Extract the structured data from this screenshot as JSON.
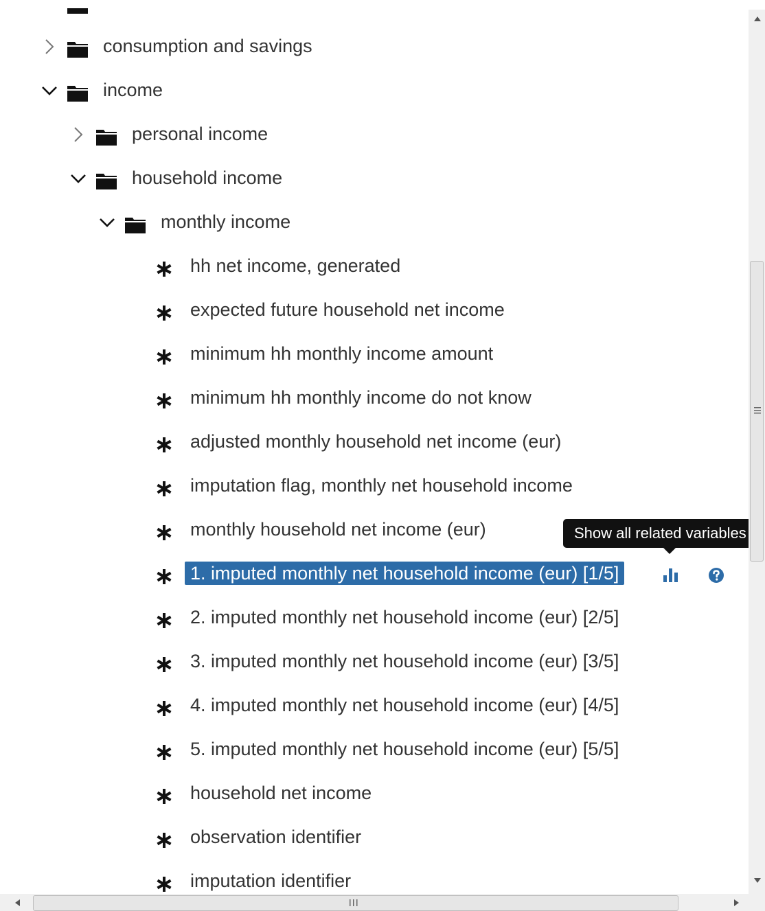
{
  "tree": {
    "nodes": [
      {
        "type": "folder",
        "level": 1,
        "state": "collapsed",
        "label": "consumption and savings"
      },
      {
        "type": "folder",
        "level": 1,
        "state": "expanded",
        "label": "income"
      },
      {
        "type": "folder",
        "level": 2,
        "state": "collapsed",
        "label": "personal income"
      },
      {
        "type": "folder",
        "level": 2,
        "state": "expanded",
        "label": "household income"
      },
      {
        "type": "folder",
        "level": 3,
        "state": "expanded",
        "label": "monthly income"
      },
      {
        "type": "variable",
        "level": 4,
        "label": "hh net income, generated"
      },
      {
        "type": "variable",
        "level": 4,
        "label": "expected future household net income"
      },
      {
        "type": "variable",
        "level": 4,
        "label": "minimum hh monthly income amount"
      },
      {
        "type": "variable",
        "level": 4,
        "label": "minimum hh monthly income do not know"
      },
      {
        "type": "variable",
        "level": 4,
        "label": "adjusted monthly household net income (eur)"
      },
      {
        "type": "variable",
        "level": 4,
        "label": "imputation flag, monthly net household income"
      },
      {
        "type": "variable",
        "level": 4,
        "label": "monthly household net income (eur)"
      },
      {
        "type": "variable",
        "level": 4,
        "label": "1. imputed monthly net household income (eur) [1/5]",
        "selected": true
      },
      {
        "type": "variable",
        "level": 4,
        "label": "2. imputed monthly net household income (eur) [2/5]"
      },
      {
        "type": "variable",
        "level": 4,
        "label": "3. imputed monthly net household income (eur) [3/5]"
      },
      {
        "type": "variable",
        "level": 4,
        "label": "4. imputed monthly net household income (eur) [4/5]"
      },
      {
        "type": "variable",
        "level": 4,
        "label": "5. imputed monthly net household income (eur) [5/5]"
      },
      {
        "type": "variable",
        "level": 4,
        "label": "household net income"
      },
      {
        "type": "variable",
        "level": 4,
        "label": "observation identifier"
      },
      {
        "type": "variable",
        "level": 4,
        "label": "imputation identifier"
      }
    ]
  },
  "tooltip": {
    "text": "Show all related variables"
  },
  "actions": {
    "related_icon": "bar-chart-icon",
    "help_icon": "question-circle-icon"
  },
  "colors": {
    "selected_bg": "#2d6ca8",
    "icon_blue": "#2d6ca8",
    "tooltip_bg": "#111111",
    "text": "#333333"
  }
}
